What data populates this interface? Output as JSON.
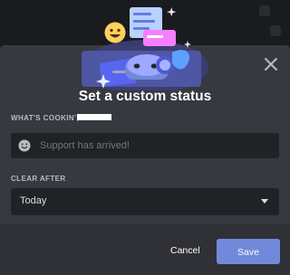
{
  "modal": {
    "title": "Set a custom status",
    "status_label": "What's cookin',",
    "status_input": {
      "value": "",
      "placeholder": "Support has arrived!"
    },
    "clear_after_label": "Clear after",
    "clear_after_value": "Today",
    "cancel_label": "Cancel",
    "save_label": "Save"
  },
  "icons": {
    "close": "close-icon",
    "emoji": "emoji-icon",
    "dropdown": "chevron-down-icon"
  },
  "colors": {
    "background": "#36393f",
    "footer": "#2f3136",
    "input": "#202225",
    "accent": "#7289da",
    "heading": "#ffffff",
    "label": "#b9bbbe",
    "placeholder": "#72767d"
  }
}
